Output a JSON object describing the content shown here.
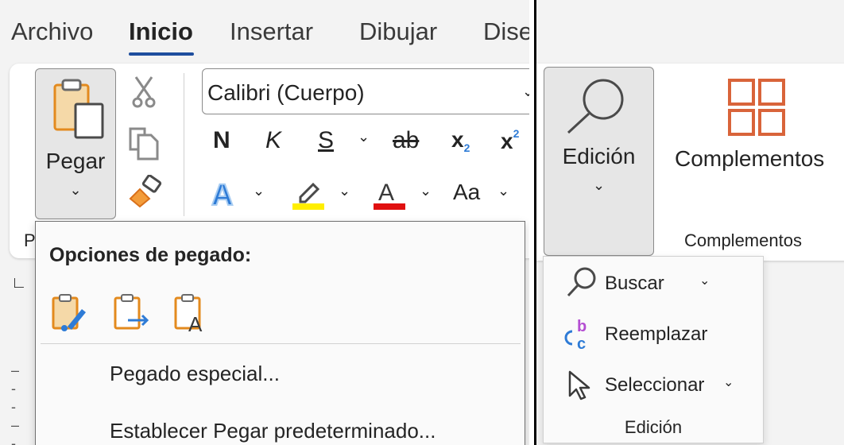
{
  "tabs": [
    "Archivo",
    "Inicio",
    "Insertar",
    "Dibujar",
    "Dise"
  ],
  "clipboard": {
    "paste_label": "Pegar",
    "group_label": "P"
  },
  "font": {
    "name": "Calibri (Cuerpo)",
    "bold": "N",
    "italic": "K",
    "underline": "S",
    "strike": "ab",
    "subscript": "x",
    "subscript_mark": "2",
    "superscript": "x",
    "superscript_mark": "2",
    "case": "Aa"
  },
  "paste_menu": {
    "title": "Opciones de pegado:",
    "items": [
      "Pegado especial...",
      "Establecer Pegar predeterminado..."
    ]
  },
  "editing": {
    "button_label": "Edición",
    "menu_items": [
      "Buscar",
      "Reemplazar",
      "Seleccionar"
    ],
    "group_label": "Edición"
  },
  "addins": {
    "label": "Complementos",
    "group_label": "Complementos"
  },
  "colors": {
    "accent": "#1f4e9e",
    "highlight": "#ffee00",
    "font_color": "#e01010",
    "addins_orange": "#d9643a",
    "text_effects_blue": "#2e7bd6"
  }
}
